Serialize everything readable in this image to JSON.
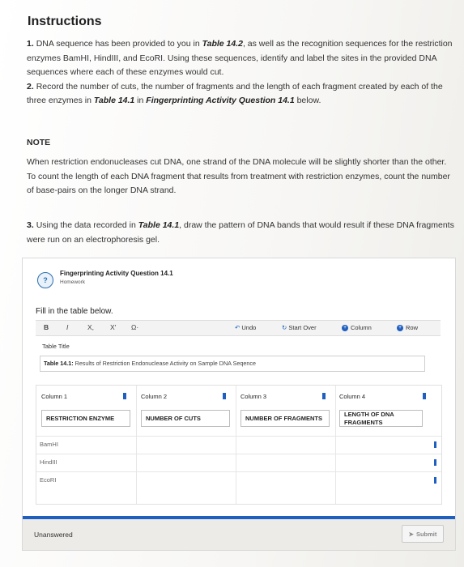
{
  "heading": "Instructions",
  "instructions": {
    "item1_num": "1.",
    "item1_a": "DNA sequence has been provided to you in ",
    "item1_table": "Table 14.2",
    "item1_b": ", as well as the recognition sequences for the restriction enzymes BamHI, HindIII, and EcoRI. Using these sequences, identify and label the sites in the provided DNA sequences where each of these enzymes would cut.",
    "item2_num": "2.",
    "item2_a": "Record the number of cuts, the number of fragments and the length of each fragment created by each of the three enzymes in ",
    "item2_table": "Table 14.1",
    "item2_b": " in ",
    "item2_q": "Fingerprinting Activity Question 14.1",
    "item2_c": " below."
  },
  "note": {
    "title": "NOTE",
    "text": "When restriction endonucleases cut DNA, one strand of the DNA molecule will be slightly shorter than the other. To count the length of each DNA fragment that results from treatment with restriction enzymes, count the number of base-pairs on the longer DNA strand."
  },
  "item3": {
    "num": "3.",
    "a": "Using the data recorded in ",
    "table": "Table 14.1",
    "b": ", draw the pattern of DNA bands that would result if these DNA fragments were run on an electrophoresis gel."
  },
  "question": {
    "title": "Fingerprinting Activity Question 14.1",
    "subtitle": "Homework",
    "prompt": "Fill in the table below.",
    "toolbar": {
      "bold": "B",
      "italic": "I",
      "subscript": "X,",
      "superscript": "X'",
      "omega": "Ω·",
      "undo": "Undo",
      "start_over": "Start Over",
      "column": "Column",
      "row": "Row"
    },
    "table_title_label": "Table Title",
    "table_title_bold": "Table 14.1:",
    "table_title_text": " Results of Restriction Endonuclease Activity on Sample DNA Seqence",
    "columns": [
      {
        "name": "Column 1",
        "header": "RESTRICTION ENZYME"
      },
      {
        "name": "Column 2",
        "header": "NUMBER OF CUTS"
      },
      {
        "name": "Column 3",
        "header": "NUMBER OF FRAGMENTS"
      },
      {
        "name": "Column 4",
        "header": "LENGTH OF DNA FRAGMENTS"
      }
    ],
    "rows": [
      "BamHI",
      "HindIII",
      "EcoRI"
    ],
    "status": "Unanswered",
    "submit": "Submit"
  },
  "colors": {
    "accent": "#1f5fbf"
  }
}
